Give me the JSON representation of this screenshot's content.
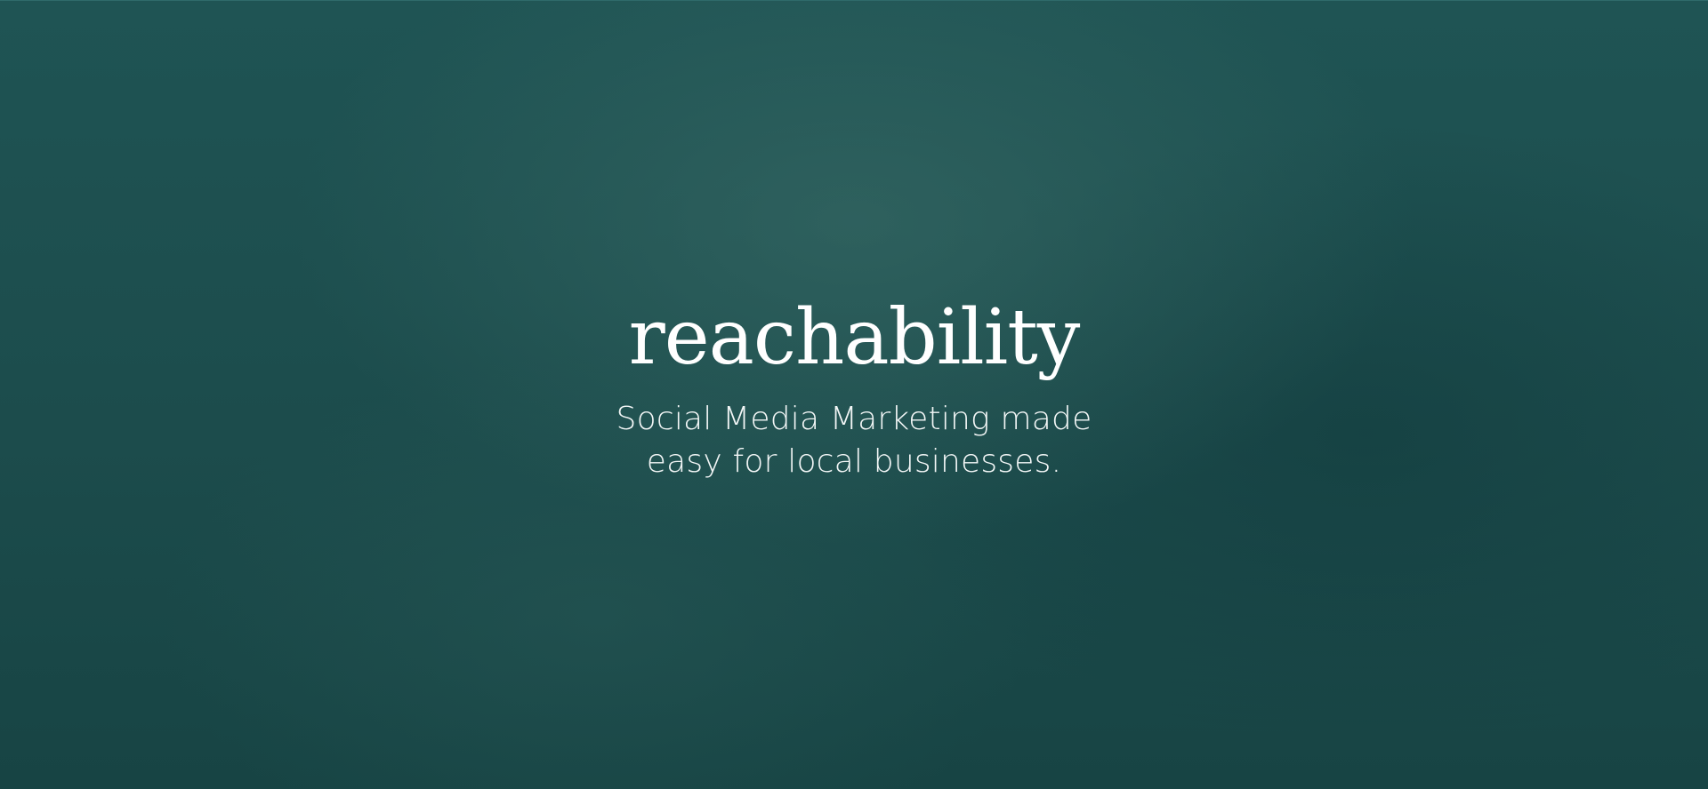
{
  "hero": {
    "brand": "reachability",
    "tagline_lines": [
      "Social Media Marketing made",
      "easy for local businesses."
    ]
  },
  "colors": {
    "background": "#1b4b4b",
    "text": "#ffffff"
  }
}
